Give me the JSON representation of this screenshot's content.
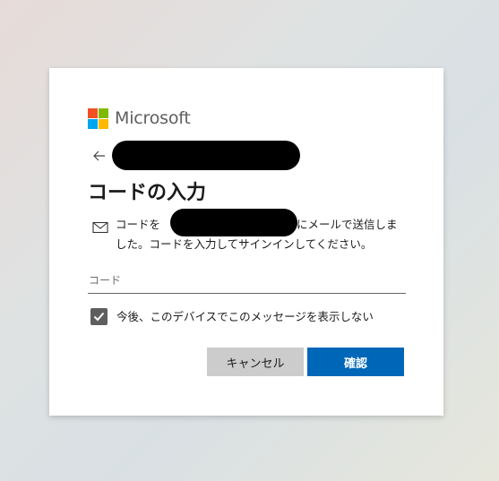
{
  "brand": {
    "name": "Microsoft",
    "colors": [
      "#f25022",
      "#7fba00",
      "#00a4ef",
      "#ffb900"
    ]
  },
  "identity": {
    "back_icon": "arrow-left-icon",
    "email": ""
  },
  "title": "コードの入力",
  "description": {
    "icon": "mail-icon",
    "prefix": "コードを",
    "suffix": "にメールで送信しました。コードを入力してサインインしてください。"
  },
  "code_field": {
    "placeholder": "コード",
    "value": ""
  },
  "remember": {
    "checked": true,
    "label": "今後、このデバイスでこのメッセージを表示しない"
  },
  "buttons": {
    "cancel": "キャンセル",
    "confirm": "確認"
  },
  "accent_color": "#0067b8"
}
